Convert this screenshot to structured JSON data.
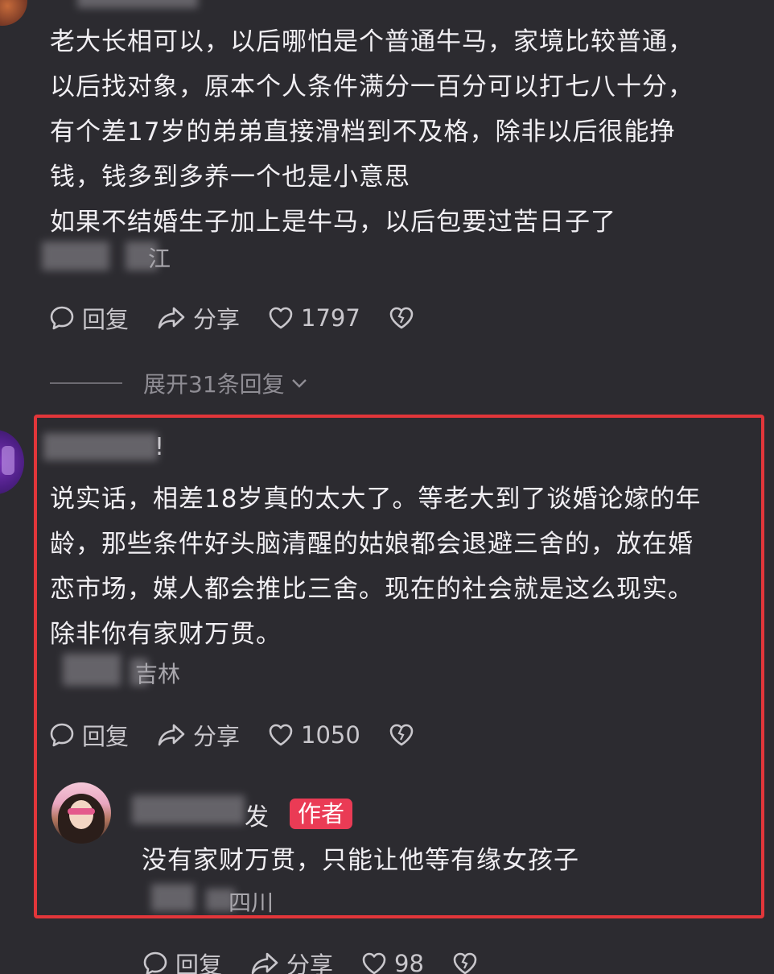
{
  "comments": [
    {
      "text": "老大长相可以，以后哪怕是个普通牛马，家境比较普通，\n以后找对象，原本个人条件满分一百分可以打七八十分，\n有个差17岁的弟弟直接滑档到不及格，除非以后很能挣\n钱，钱多到多养一个也是小意思\n如果不结婚生子加上是牛马，以后包要过苦日子了",
      "location": "江",
      "actions": {
        "reply": "回复",
        "share": "分享",
        "likes": "1797"
      },
      "expand_label": "展开31条回复"
    },
    {
      "name_tail": "!",
      "text": "说实话，相差18岁真的太大了。等老大到了谈婚论嫁的年\n龄，那些条件好头脑清醒的姑娘都会退避三舍的，放在婚\n恋市场，媒人都会推比三舍。现在的社会就是这么现实。\n除非你有家财万贯。",
      "location": "吉林",
      "actions": {
        "reply": "回复",
        "share": "分享",
        "likes": "1050"
      }
    },
    {
      "name_tail": "发",
      "badge": "作者",
      "text": "没有家财万贯，只能让他等有缘女孩子",
      "location": "四川",
      "actions": {
        "reply": "回复",
        "share": "分享",
        "likes": "98"
      }
    }
  ],
  "colors": {
    "background": "#2c2b30",
    "highlight_border": "#e2363a",
    "badge": "#ea3b55"
  },
  "icons": [
    "comment-icon",
    "share-icon",
    "heart-icon",
    "broken-heart-icon",
    "chevron-down-icon"
  ]
}
